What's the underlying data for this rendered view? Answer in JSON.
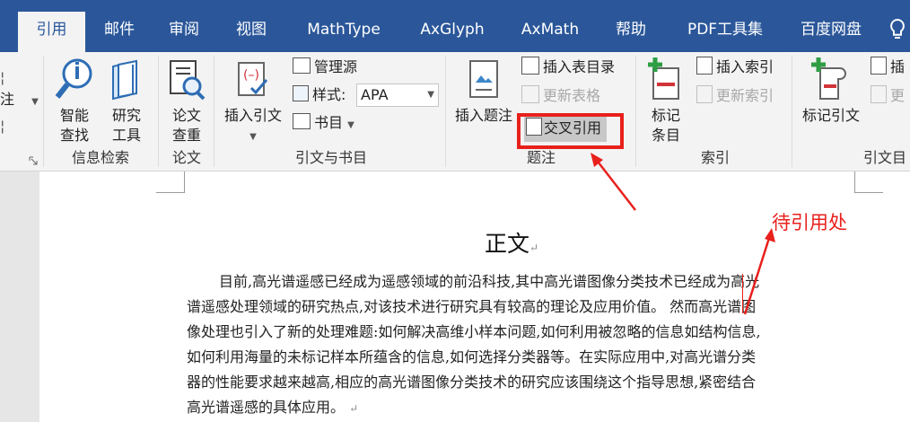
{
  "tabs": [
    {
      "label": "引用",
      "active": true
    },
    {
      "label": "邮件"
    },
    {
      "label": "审阅"
    },
    {
      "label": "视图"
    },
    {
      "label": "MathType"
    },
    {
      "label": "AxGlyph"
    },
    {
      "label": "AxMath"
    },
    {
      "label": "帮助"
    },
    {
      "label": "PDF工具集"
    },
    {
      "label": "百度网盘"
    }
  ],
  "help_icon": "lightbulb-icon",
  "ribbon": {
    "left_partial": {
      "item1": "注",
      "arrow": "▾"
    },
    "info_search": {
      "group_label": "信息检索",
      "smart_lookup": "智能\n查找",
      "smart_lookup_l1": "智能",
      "smart_lookup_l2": "查找",
      "researcher_l1": "研究",
      "researcher_l2": "工具"
    },
    "paper": {
      "group_label": "论文",
      "check_l1": "论文",
      "check_l2": "查重"
    },
    "citations": {
      "group_label": "引文与书目",
      "insert_citation": "插入引文",
      "manage_sources": "管理源",
      "style_label": "样式:",
      "style_value": "APA",
      "bibliography": "书目"
    },
    "captions": {
      "group_label": "题注",
      "insert_caption": "插入题注",
      "insert_table_of_figures": "插入表目录",
      "update_table": "更新表格",
      "cross_reference": "交叉引用"
    },
    "index": {
      "group_label": "索引",
      "mark_entry_l1": "标记",
      "mark_entry_l2": "条目",
      "insert_index": "插入索引",
      "update_index": "更新索引"
    },
    "toa": {
      "group_label": "引文目",
      "mark_citation": "标记引文",
      "insert_partial": "插",
      "update_partial": "更"
    }
  },
  "document": {
    "title": "正文",
    "lines": [
      "目前,高光谱遥感已经成为遥感领域的前沿科技,其中高光谱图像分类技术已经成为高光",
      "谱遥感处理领域的研究热点,对该技术进行研究具有较高的理论及应用价值。 然而高光谱图",
      "像处理也引入了新的处理难题:如何解决高维小样本问题,如何利用被忽略的信息如结构信息,",
      "如何利用海量的未标记样本所蕴含的信息,如何选择分类器等。在实际应用中,对高光谱分类",
      "器的性能要求越来越高,相应的高光谱图像分类技术的研究应该围绕这个指导思想,紧密结合",
      "高光谱遥感的具体应用。"
    ],
    "paragraph_mark": "↵"
  },
  "annotation": {
    "label": "待引用处",
    "color": "#e8201c"
  },
  "colors": {
    "tabbar": "#2b579a",
    "ribbon": "#f3f3f3",
    "accent_red": "#e8201c"
  }
}
